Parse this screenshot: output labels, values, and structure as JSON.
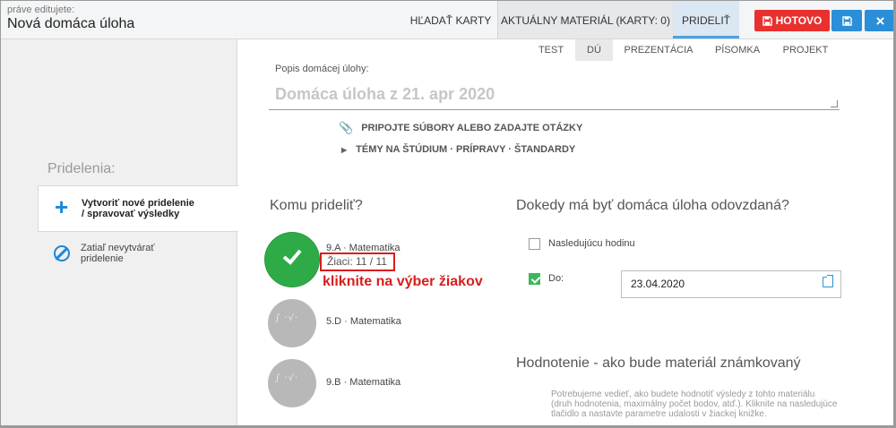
{
  "header": {
    "editing_label": "práve editujete:",
    "document_title": "Nová domáca úloha",
    "tabs": [
      {
        "label": "HĽADAŤ KARTY"
      },
      {
        "label": "AKTUÁLNY MATERIÁL (KARTY: 0)"
      },
      {
        "label": "PRIDELIŤ",
        "active": true
      }
    ],
    "done_label": "HOTOVO",
    "save_icon": "floppy-disk-icon",
    "close_icon": "close-icon",
    "colors": {
      "done": "#e8312f",
      "primary": "#2b8ed8"
    }
  },
  "sidebar": {
    "heading": "Pridelenia:",
    "items": [
      {
        "label": "Vytvoriť nové pridelenie / spravovať výsledky",
        "icon": "plus-icon",
        "active": true
      },
      {
        "label": "Zatiaľ nevytvárať pridelenie",
        "icon": "ban-icon",
        "active": false
      }
    ]
  },
  "material_tabs": [
    {
      "label": "TEST"
    },
    {
      "label": "DÚ",
      "active": true
    },
    {
      "label": "PREZENTÁCIA"
    },
    {
      "label": "PÍSOMKA"
    },
    {
      "label": "PROJEKT"
    }
  ],
  "description": {
    "label": "Popis domácej úlohy:",
    "value": "Domáca úloha z 21. apr 2020",
    "attach_label": "PRIPOJTE SÚBORY ALEBO ZADAJTE OTÁZKY",
    "topics_label": "TÉMY NA ŠTÚDIUM · PRÍPRAVY · ŠTANDARDY"
  },
  "assign": {
    "heading": "Komu prideliť?",
    "classes": [
      {
        "name": "9.A · Matematika",
        "students": "Žiaci: 11 / 11",
        "selected": true
      },
      {
        "name": "5.D · Matematika",
        "selected": false
      },
      {
        "name": "9.B · Matematika",
        "selected": false
      }
    ],
    "callout": "kliknite na výber žiakov",
    "callout_color": "#d81d1d"
  },
  "due": {
    "heading": "Dokedy má byť domáca úloha odovzdaná?",
    "next_lesson_label": "Nasledujúcu hodinu",
    "next_lesson_checked": false,
    "until_label": "Do:",
    "until_checked": true,
    "date": "23.04.2020"
  },
  "grading": {
    "heading": "Hodnotenie - ako bude materiál známkovaný",
    "text": "Potrebujeme vedieť, ako budete hodnotiť výsledy z tohto materiálu (druh hodnotenia, maximálny počet bodov, atď.). Kliknite na nasledujúce tlačidlo a nastavte parametre udalosti v žiackej knižke."
  }
}
